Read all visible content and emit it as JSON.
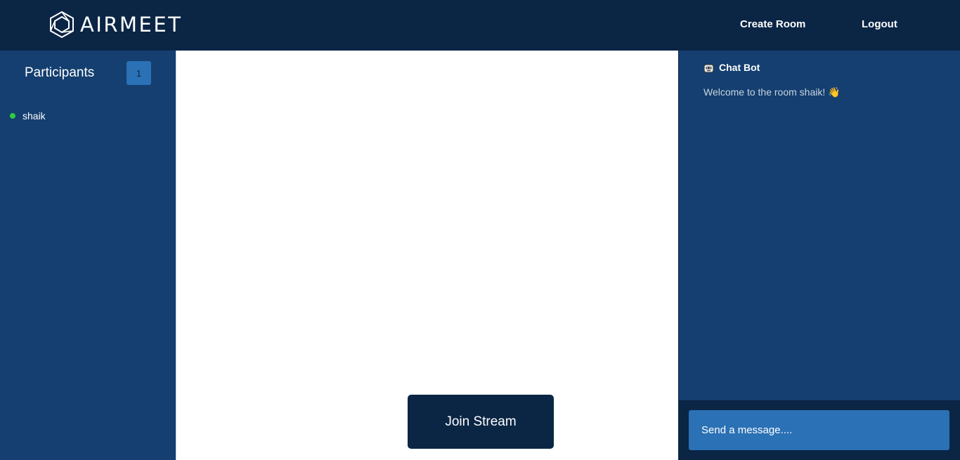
{
  "navbar": {
    "brand": "AIRMEET",
    "create_room": "Create Room",
    "logout": "Logout"
  },
  "participants": {
    "title": "Participants",
    "count": "1",
    "list": [
      {
        "name": "shaik",
        "status": "online"
      }
    ]
  },
  "stage": {
    "join_button": "Join Stream"
  },
  "chat": {
    "messages": [
      {
        "sender": "Chat Bot",
        "icon": "robot-icon",
        "text": "Welcome to the room shaik!",
        "emoji": "👋"
      }
    ],
    "input_placeholder": "Send a message...."
  },
  "colors": {
    "navbar": "#0b2545",
    "panel": "#143f70",
    "accent": "#2b71b5",
    "online": "#2ecc40"
  }
}
